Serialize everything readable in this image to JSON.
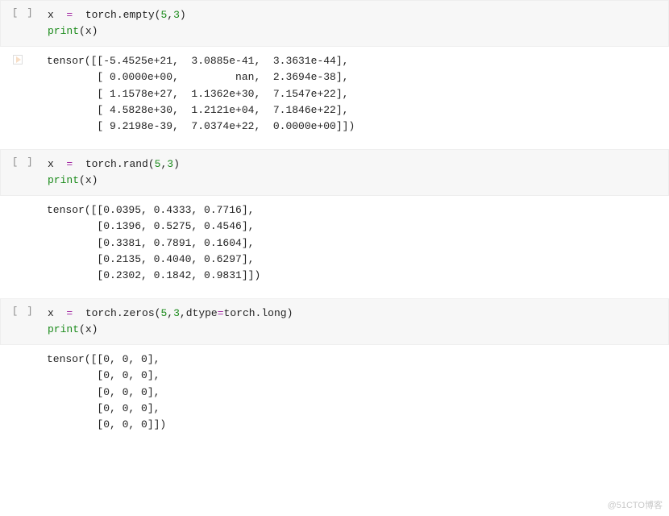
{
  "cells": [
    {
      "prompt": "[ ]",
      "code_tokens": [
        {
          "t": "x  ",
          "c": "kw-var"
        },
        {
          "t": "=",
          "c": "op"
        },
        {
          "t": "  torch.",
          "c": "fn"
        },
        {
          "t": "empty",
          "c": "fn"
        },
        {
          "t": "(",
          "c": "paren"
        },
        {
          "t": "5",
          "c": "num"
        },
        {
          "t": ",",
          "c": "paren"
        },
        {
          "t": "3",
          "c": "num"
        },
        {
          "t": ")",
          "c": "paren"
        },
        {
          "t": "\n",
          "c": ""
        },
        {
          "t": "print",
          "c": "builtin"
        },
        {
          "t": "(x)",
          "c": "paren"
        }
      ],
      "output": "tensor([[-5.4525e+21,  3.0885e-41,  3.3631e-44],\n        [ 0.0000e+00,         nan,  2.3694e-38],\n        [ 1.1578e+27,  1.1362e+30,  7.1547e+22],\n        [ 4.5828e+30,  1.2121e+04,  7.1846e+22],\n        [ 9.2198e-39,  7.0374e+22,  0.0000e+00]])"
    },
    {
      "prompt": "[ ]",
      "code_tokens": [
        {
          "t": "x  ",
          "c": "kw-var"
        },
        {
          "t": "=",
          "c": "op"
        },
        {
          "t": "  torch.",
          "c": "fn"
        },
        {
          "t": "rand",
          "c": "fn"
        },
        {
          "t": "(",
          "c": "paren"
        },
        {
          "t": "5",
          "c": "num"
        },
        {
          "t": ",",
          "c": "paren"
        },
        {
          "t": "3",
          "c": "num"
        },
        {
          "t": ")",
          "c": "paren"
        },
        {
          "t": "\n",
          "c": ""
        },
        {
          "t": "print",
          "c": "builtin"
        },
        {
          "t": "(x)",
          "c": "paren"
        }
      ],
      "output": "tensor([[0.0395, 0.4333, 0.7716],\n        [0.1396, 0.5275, 0.4546],\n        [0.3381, 0.7891, 0.1604],\n        [0.2135, 0.4040, 0.6297],\n        [0.2302, 0.1842, 0.9831]])"
    },
    {
      "prompt": "[ ]",
      "code_tokens": [
        {
          "t": "x  ",
          "c": "kw-var"
        },
        {
          "t": "=",
          "c": "op"
        },
        {
          "t": "  torch.",
          "c": "fn"
        },
        {
          "t": "zeros",
          "c": "fn"
        },
        {
          "t": "(",
          "c": "paren"
        },
        {
          "t": "5",
          "c": "num"
        },
        {
          "t": ",",
          "c": "paren"
        },
        {
          "t": "3",
          "c": "num"
        },
        {
          "t": ",",
          "c": "paren"
        },
        {
          "t": "dtype",
          "c": "kw-var"
        },
        {
          "t": "=",
          "c": "op"
        },
        {
          "t": "torch.",
          "c": "fn"
        },
        {
          "t": "long",
          "c": "fn"
        },
        {
          "t": ")",
          "c": "paren"
        },
        {
          "t": "\n",
          "c": ""
        },
        {
          "t": "print",
          "c": "builtin"
        },
        {
          "t": "(x)",
          "c": "paren"
        }
      ],
      "output": "tensor([[0, 0, 0],\n        [0, 0, 0],\n        [0, 0, 0],\n        [0, 0, 0],\n        [0, 0, 0]])"
    }
  ],
  "watermark": "@51CTO博客"
}
